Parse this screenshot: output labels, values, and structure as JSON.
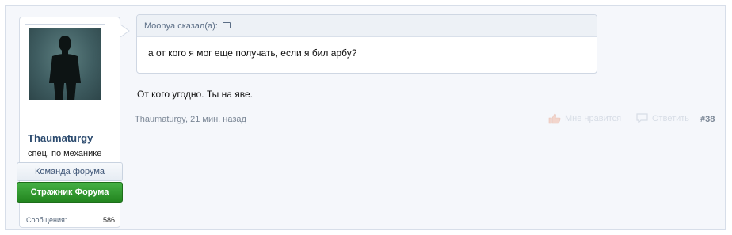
{
  "user": {
    "name": "Thaumaturgy",
    "title": "спец. по механике",
    "banner_team": "Команда форума",
    "banner_guard": "Стражник Форума",
    "messages_label": "Сообщения:",
    "messages_count": "586"
  },
  "quote": {
    "author_line": "Moonya сказал(а):",
    "text": "а от кого я мог еще получать, если я бил арбу?"
  },
  "message": {
    "text": "От кого угодно. Ты на яве."
  },
  "meta": {
    "author_time": "Thaumaturgy, 21 мин. назад",
    "like_label": "Мне нравится",
    "reply_label": "Ответить",
    "post_number": "#38"
  },
  "colors": {
    "username": "#2b4a6e",
    "guard_banner": "#2f9b2c",
    "faded_action": "#d7dde6"
  }
}
